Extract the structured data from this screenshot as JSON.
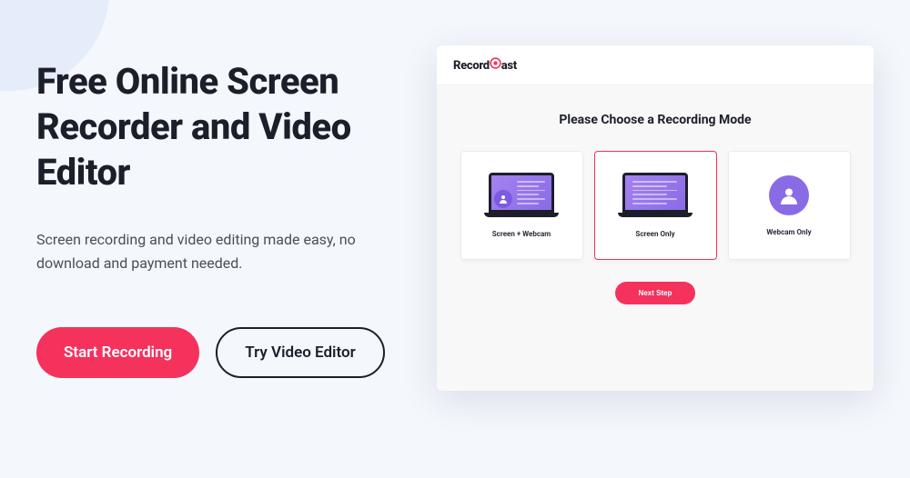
{
  "hero": {
    "headline": "Free Online Screen Recorder and Video Editor",
    "subtext": "Screen recording and video editing made easy, no download and payment needed.",
    "primary_cta": "Start Recording",
    "secondary_cta": "Try Video Editor"
  },
  "preview": {
    "brand_prefix": "Record",
    "brand_suffix": "ast",
    "title": "Please Choose a Recording Mode",
    "modes": [
      {
        "label": "Screen + Webcam"
      },
      {
        "label": "Screen Only"
      },
      {
        "label": "Webcam Only"
      }
    ],
    "next_label": "Next Step"
  },
  "colors": {
    "accent": "#f4325c",
    "dark": "#1c1f2a",
    "purple": "#8a6be6"
  }
}
